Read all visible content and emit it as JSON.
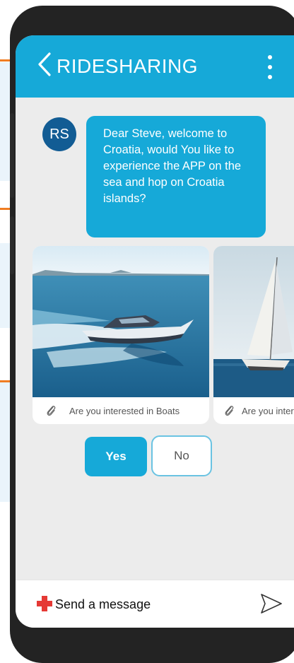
{
  "app": {
    "title": "RIDESHARING"
  },
  "chat": {
    "avatar_initials": "RS",
    "message": "Dear Steve, welcome to Croatia, would You like to experience the APP on the sea and hop on Croatia islands?"
  },
  "cards": [
    {
      "caption": "Are you interested in Boats",
      "image": "speedboat"
    },
    {
      "caption": "Are you inter",
      "image": "sailboat"
    }
  ],
  "actions": {
    "yes": "Yes",
    "no": "No"
  },
  "composer": {
    "placeholder": "Send a message"
  },
  "colors": {
    "accent": "#16a9d8",
    "avatar": "#125c94",
    "plus": "#e53935",
    "annotation_line": "#f07d22"
  },
  "icons": [
    "back-chevron-icon",
    "more-vertical-icon",
    "paperclip-icon",
    "add-icon",
    "send-icon"
  ]
}
